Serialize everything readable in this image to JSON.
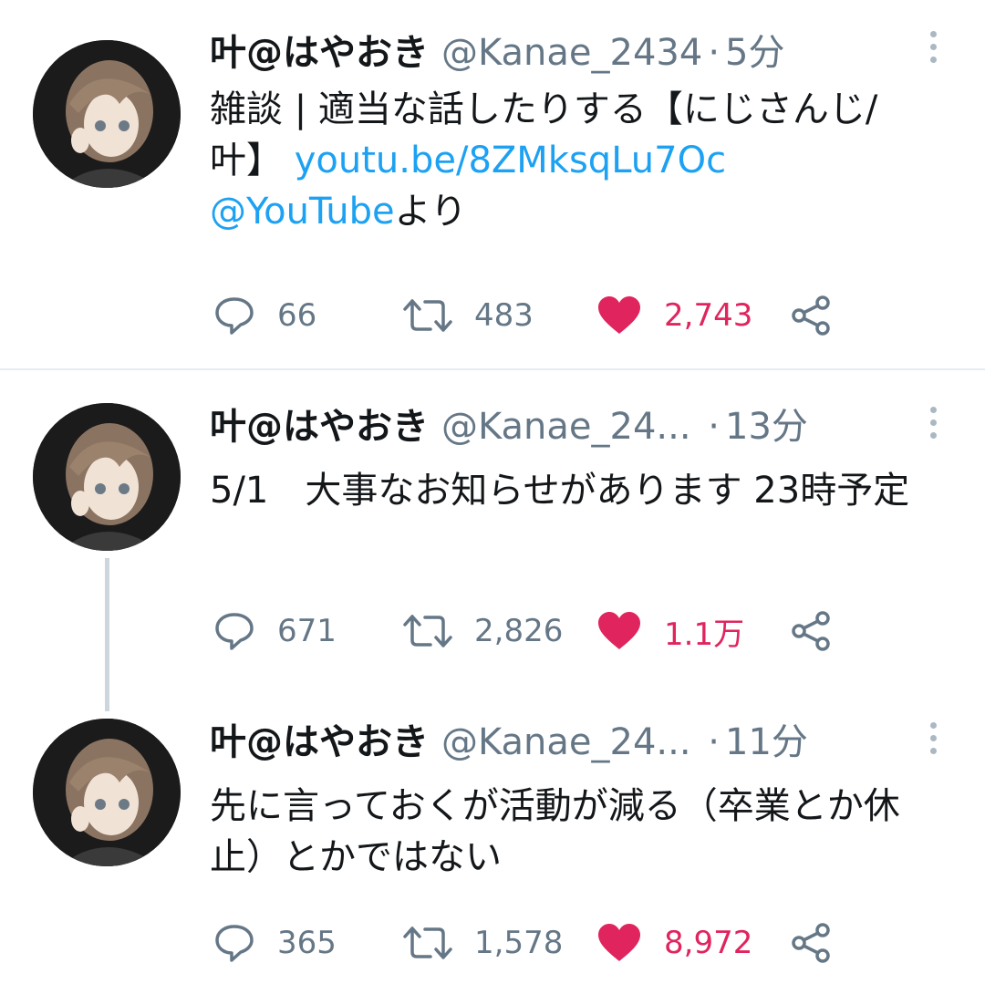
{
  "tweets": [
    {
      "name": "叶@はやおき",
      "handle": "@Kanae_2434",
      "time": "5分",
      "text": "雑談 | 適当な話したりする【にじさんじ/叶】 ",
      "link": "youtu.be/8ZMksqLu7Oc",
      "mention": "@YouTube",
      "mention_suffix": "より",
      "replies": "66",
      "retweets": "483",
      "likes": "2,743"
    },
    {
      "name": "叶@はやおき",
      "handle": "@Kanae_24...",
      "time": "13分",
      "text": "5/1　大事なお知らせがあります 23時予定",
      "replies": "671",
      "retweets": "2,826",
      "likes": "1.1万"
    },
    {
      "name": "叶@はやおき",
      "handle": "@Kanae_24...",
      "time": "11分",
      "text": "先に言っておくが活動が減る（卒業とか休止）とかではない",
      "replies": "365",
      "retweets": "1,578",
      "likes": "8,972"
    }
  ],
  "colors": {
    "text": "#14171a",
    "secondary": "#657786",
    "link": "#1da1f2",
    "like": "#e0245e",
    "thread_line": "#ccd6dd"
  },
  "icons": [
    "reply-icon",
    "retweet-icon",
    "heart-icon",
    "share-icon",
    "more-icon"
  ]
}
